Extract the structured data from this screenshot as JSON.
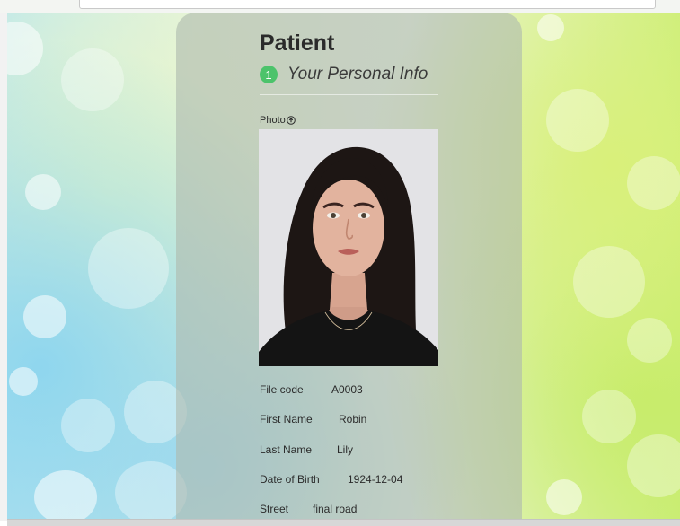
{
  "page": {
    "title": "Patient",
    "step": {
      "number": "1",
      "label": "Your Personal Info"
    },
    "photo_label": "Photo",
    "photo_icon": "upload-circle-icon"
  },
  "fields": [
    {
      "label": "File code",
      "value": "A0003"
    },
    {
      "label": "First Name",
      "value": "Robin"
    },
    {
      "label": "Last Name",
      "value": "Lily"
    },
    {
      "label": "Date of Birth",
      "value": "1924-12-04"
    },
    {
      "label": "Street",
      "value": "final road"
    }
  ],
  "colors": {
    "accent": "#4cc36b",
    "card": "#afb9af",
    "text": "#2b2b2b"
  }
}
